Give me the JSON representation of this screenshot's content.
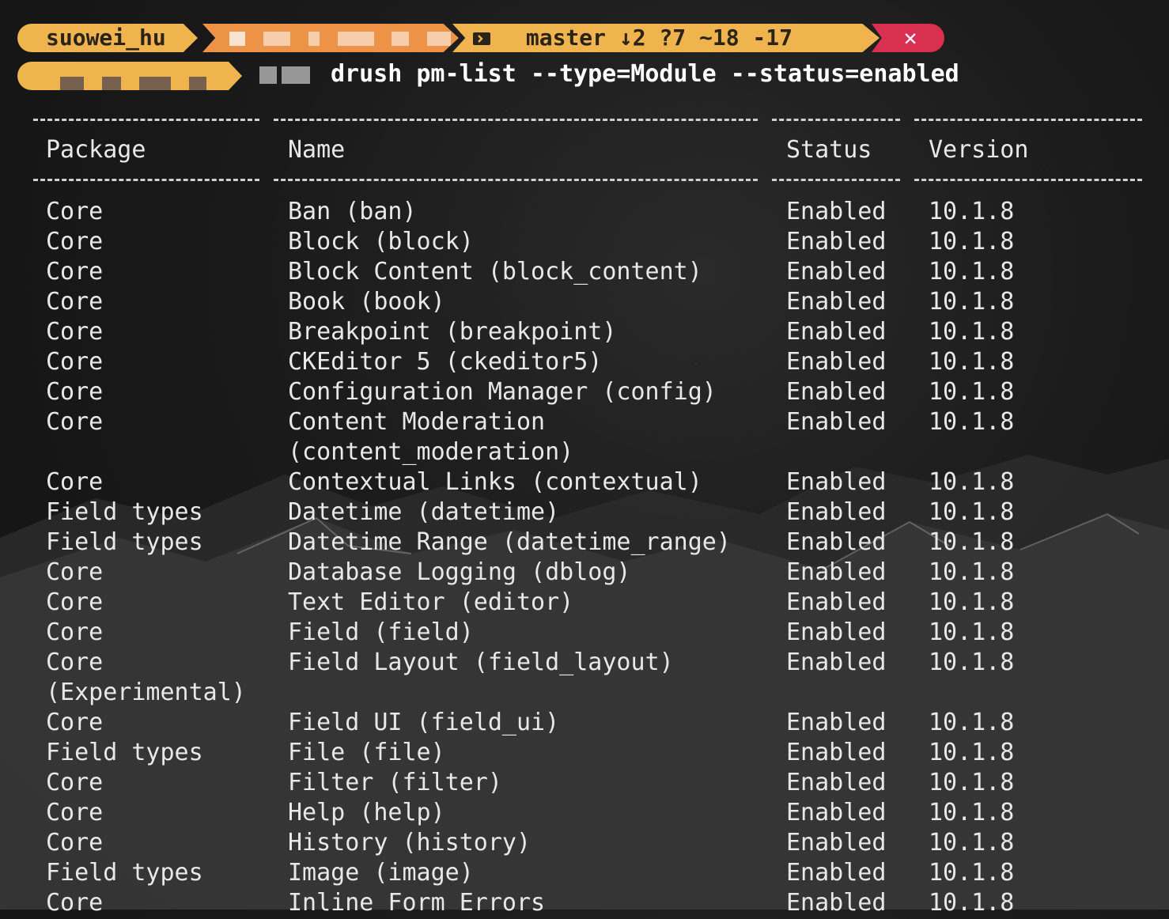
{
  "prompt": {
    "user": "suowei_hu",
    "git_status": "master ↓2 ?7 ~18 -17",
    "close_glyph": "✕",
    "command": "drush pm-list --type=Module --status=enabled",
    "accent_colors": {
      "user": "#f0b44e",
      "dir": "#ec9347",
      "close": "#d9304f"
    }
  },
  "table": {
    "headers": {
      "package": "Package",
      "name": "Name",
      "status": "Status",
      "version": "Version"
    },
    "rows": [
      {
        "package": "Core",
        "name": "Ban (ban)",
        "status": "Enabled",
        "version": "10.1.8"
      },
      {
        "package": "Core",
        "name": "Block (block)",
        "status": "Enabled",
        "version": "10.1.8"
      },
      {
        "package": "Core",
        "name": "Block Content (block_content)",
        "status": "Enabled",
        "version": "10.1.8"
      },
      {
        "package": "Core",
        "name": "Book (book)",
        "status": "Enabled",
        "version": "10.1.8"
      },
      {
        "package": "Core",
        "name": "Breakpoint (breakpoint)",
        "status": "Enabled",
        "version": "10.1.8"
      },
      {
        "package": "Core",
        "name": "CKEditor 5 (ckeditor5)",
        "status": "Enabled",
        "version": "10.1.8"
      },
      {
        "package": "Core",
        "name": "Configuration Manager (config)",
        "status": "Enabled",
        "version": "10.1.8"
      },
      {
        "package": "Core",
        "name": "Content Moderation",
        "status": "Enabled",
        "version": "10.1.8"
      },
      {
        "package": "",
        "name": "(content_moderation)",
        "status": "",
        "version": ""
      },
      {
        "package": "Core",
        "name": "Contextual Links (contextual)",
        "status": "Enabled",
        "version": "10.1.8"
      },
      {
        "package": "Field types",
        "name": "Datetime (datetime)",
        "status": "Enabled",
        "version": "10.1.8"
      },
      {
        "package": "Field types",
        "name": "Datetime Range (datetime_range)",
        "status": "Enabled",
        "version": "10.1.8"
      },
      {
        "package": "Core",
        "name": "Database Logging (dblog)",
        "status": "Enabled",
        "version": "10.1.8"
      },
      {
        "package": "Core",
        "name": "Text Editor (editor)",
        "status": "Enabled",
        "version": "10.1.8"
      },
      {
        "package": "Core",
        "name": "Field (field)",
        "status": "Enabled",
        "version": "10.1.8"
      },
      {
        "package": "Core",
        "name": "Field Layout (field_layout)",
        "status": "Enabled",
        "version": "10.1.8"
      },
      {
        "package": "(Experimental)",
        "name": "",
        "status": "",
        "version": ""
      },
      {
        "package": "Core",
        "name": "Field UI (field_ui)",
        "status": "Enabled",
        "version": "10.1.8"
      },
      {
        "package": "Field types",
        "name": "File (file)",
        "status": "Enabled",
        "version": "10.1.8"
      },
      {
        "package": "Core",
        "name": "Filter (filter)",
        "status": "Enabled",
        "version": "10.1.8"
      },
      {
        "package": "Core",
        "name": "Help (help)",
        "status": "Enabled",
        "version": "10.1.8"
      },
      {
        "package": "Core",
        "name": "History (history)",
        "status": "Enabled",
        "version": "10.1.8"
      },
      {
        "package": "Field types",
        "name": "Image (image)",
        "status": "Enabled",
        "version": "10.1.8"
      },
      {
        "package": "Core",
        "name": "Inline Form Errors",
        "status": "Enabled",
        "version": "10.1.8"
      }
    ]
  }
}
